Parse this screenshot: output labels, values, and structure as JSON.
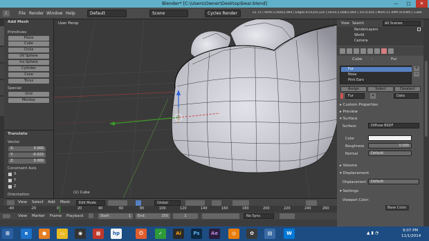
{
  "window": {
    "title": "Blender* [C:\\Users\\Owner\\Desktop\\bear.blend]",
    "minimize": "—",
    "maximize": "□",
    "close": "✕"
  },
  "menubar": {
    "info_icon": "i",
    "items": [
      "File",
      "Render",
      "Window",
      "Help"
    ],
    "layout": "Default",
    "scene": "Scene",
    "engine": "Cycles Render",
    "stats": "v2.72 | Verts:2,004/2,064 | Edges:4,012/4,124 | Faces:2,008/2,064 | Tris:4,016 | Mem:11.49M (9.65M) | Cube"
  },
  "toolshelf": {
    "header": "Add Mesh",
    "primitives_label": "Primitives",
    "primitives": [
      "Plane",
      "Cube",
      "Circle",
      "UV Sphere",
      "Ico Sphere",
      "Cylinder",
      "Cone",
      "Torus"
    ],
    "special_label": "Special",
    "special": [
      "Grid",
      "Monkey"
    ],
    "tabs": [
      "Create",
      "Tools",
      "Relations",
      "Physics",
      "Grease Pencil"
    ]
  },
  "operator": {
    "header": "Translate",
    "vector_label": "Vector",
    "x": "X:",
    "x_val": "0.000",
    "y": "Y:",
    "y_val": "-0.023",
    "z": "Z:",
    "z_val": "0.000",
    "constraint_label": "Constraint Axis",
    "axes": [
      "X",
      "Y",
      "Z"
    ],
    "orientation": "Orientation"
  },
  "viewport": {
    "label": "User Persp",
    "object": "(1) Cube"
  },
  "outliner": {
    "view": "View",
    "search": "Search",
    "scenes": "All Scenes",
    "items": [
      "RenderLayers",
      "World",
      "Camera"
    ]
  },
  "properties": {
    "breadcrumb_object": "Cube",
    "breadcrumb_material": "Fur",
    "materials": [
      "Fur",
      "Nose",
      "Pink Ears"
    ],
    "assign": "Assign",
    "select": "Select",
    "deselect": "Deselect",
    "material_name": "Fur",
    "count": "4",
    "data_mode": "Data",
    "sections": {
      "custom_props": "Custom Properties",
      "preview": "Preview",
      "surface": "Surface",
      "volume": "Volume",
      "displacement": "Displacement",
      "settings": "Settings"
    },
    "surface_label": "Surface:",
    "surface_value": "Diffuse BSDF",
    "color_label": "Color",
    "roughness_label": "Roughness",
    "roughness_value": "0.000",
    "normal_label": "Normal",
    "normal_value": "Default",
    "displacement_label": "Displacement",
    "displacement_value": "Default",
    "viewport_color": "Viewport Color:",
    "base_color": "Base Color:"
  },
  "viewport_header": {
    "view": "View",
    "select": "Select",
    "add": "Add",
    "mesh": "Mesh",
    "mode": "Edit Mode",
    "orientation": "Global"
  },
  "timeline": {
    "ticks": [
      "-40",
      "-20",
      "0",
      "20",
      "40",
      "60",
      "80",
      "100",
      "120",
      "140",
      "160",
      "180",
      "200",
      "220",
      "240",
      "260"
    ]
  },
  "timeline_header": {
    "view": "View",
    "marker": "Marker",
    "frame": "Frame",
    "playback": "Playback",
    "start_label": "Start:",
    "start_val": "1",
    "end_label": "End:",
    "end_val": "250",
    "current": "1",
    "sync": "No Sync"
  },
  "taskbar": {
    "time": "9:07 PM",
    "date": "11/1/2014"
  },
  "colors": {
    "accent": "#5680c2",
    "titlebar": "#5fb0c8",
    "taskbar": "#1d4c82"
  }
}
